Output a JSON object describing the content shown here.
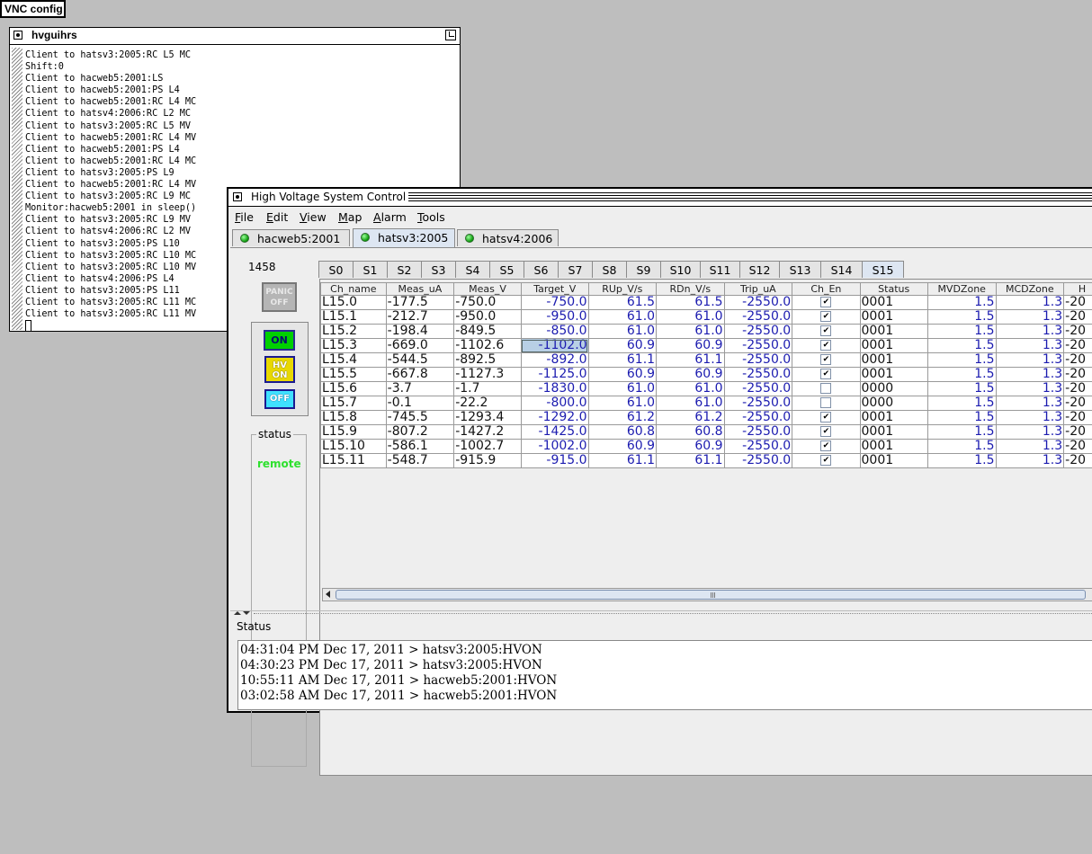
{
  "vnc_label": "VNC config",
  "terminal": {
    "title": "hvguihrs",
    "lines": [
      "Client to hatsv3:2005:RC L5 MC",
      "Shift:0",
      "Client to hacweb5:2001:LS",
      "Client to hacweb5:2001:PS L4",
      "Client to hacweb5:2001:RC L4 MC",
      "Client to hatsv4:2006:RC L2 MC",
      "Client to hatsv3:2005:RC L5 MV",
      "Client to hacweb5:2001:RC L4 MV",
      "Client to hacweb5:2001:PS L4",
      "Client to hacweb5:2001:RC L4 MC",
      "Client to hatsv3:2005:PS L9",
      "Client to hacweb5:2001:RC L4 MV",
      "Client to hatsv3:2005:RC L9 MC",
      "Monitor:hacweb5:2001 in sleep()",
      "Client to hatsv3:2005:RC L9 MV",
      "Client to hatsv4:2006:RC L2 MV",
      "Client to hatsv3:2005:PS L10",
      "Client to hatsv3:2005:RC L10 MC",
      "Client to hatsv3:2005:RC L10 MV",
      "Client to hatsv4:2006:PS L4",
      "Client to hatsv3:2005:PS L11",
      "Client to hatsv3:2005:RC L11 MC",
      "Client to hatsv3:2005:RC L11 MV"
    ]
  },
  "window": {
    "title": "High Voltage System Control"
  },
  "menu": [
    {
      "key": "F",
      "rest": "ile"
    },
    {
      "key": "E",
      "rest": "dit"
    },
    {
      "key": "V",
      "rest": "iew"
    },
    {
      "key": "M",
      "rest": "ap"
    },
    {
      "key": "A",
      "rest": "larm"
    },
    {
      "key": "T",
      "rest": "ools"
    }
  ],
  "servers": [
    "hacweb5:2001",
    "hatsv3:2005",
    "hatsv4:2006"
  ],
  "selected_server": 1,
  "left_panel": {
    "number": "1458",
    "panic_line1": "PANIC",
    "panic_line2": "OFF",
    "on_label": "ON",
    "hv_line1": "HV",
    "hv_line2": "ON",
    "off_label": "OFF",
    "status_label": "status",
    "status_value": "remote",
    "status_color": "#2fe02f"
  },
  "sectors": [
    "S0",
    "S1",
    "S2",
    "S3",
    "S4",
    "S5",
    "S6",
    "S7",
    "S8",
    "S9",
    "S10",
    "S11",
    "S12",
    "S13",
    "S14",
    "S15"
  ],
  "selected_sector": 15,
  "table": {
    "columns": [
      "Ch_name",
      "Meas_uA",
      "Meas_V",
      "Target_V",
      "RUp_V/s",
      "RDn_V/s",
      "Trip_uA",
      "Ch_En",
      "Status",
      "MVDZone",
      "MCDZone",
      "H"
    ],
    "rows": [
      [
        "L15.0",
        "-177.5",
        "-750.0",
        "-750.0",
        "61.5",
        "61.5",
        "-2550.0",
        true,
        "0001",
        "1.5",
        "1.3",
        "-20"
      ],
      [
        "L15.1",
        "-212.7",
        "-950.0",
        "-950.0",
        "61.0",
        "61.0",
        "-2550.0",
        true,
        "0001",
        "1.5",
        "1.3",
        "-20"
      ],
      [
        "L15.2",
        "-198.4",
        "-849.5",
        "-850.0",
        "61.0",
        "61.0",
        "-2550.0",
        true,
        "0001",
        "1.5",
        "1.3",
        "-20"
      ],
      [
        "L15.3",
        "-669.0",
        "-1102.6",
        "-1102.0",
        "60.9",
        "60.9",
        "-2550.0",
        true,
        "0001",
        "1.5",
        "1.3",
        "-20"
      ],
      [
        "L15.4",
        "-544.5",
        "-892.5",
        "-892.0",
        "61.1",
        "61.1",
        "-2550.0",
        true,
        "0001",
        "1.5",
        "1.3",
        "-20"
      ],
      [
        "L15.5",
        "-667.8",
        "-1127.3",
        "-1125.0",
        "60.9",
        "60.9",
        "-2550.0",
        true,
        "0001",
        "1.5",
        "1.3",
        "-20"
      ],
      [
        "L15.6",
        "-3.7",
        "-1.7",
        "-1830.0",
        "61.0",
        "61.0",
        "-2550.0",
        false,
        "0000",
        "1.5",
        "1.3",
        "-20"
      ],
      [
        "L15.7",
        "-0.1",
        "-22.2",
        "-800.0",
        "61.0",
        "61.0",
        "-2550.0",
        false,
        "0000",
        "1.5",
        "1.3",
        "-20"
      ],
      [
        "L15.8",
        "-745.5",
        "-1293.4",
        "-1292.0",
        "61.2",
        "61.2",
        "-2550.0",
        true,
        "0001",
        "1.5",
        "1.3",
        "-20"
      ],
      [
        "L15.9",
        "-807.2",
        "-1427.2",
        "-1425.0",
        "60.8",
        "60.8",
        "-2550.0",
        true,
        "0001",
        "1.5",
        "1.3",
        "-20"
      ],
      [
        "L15.10",
        "-586.1",
        "-1002.7",
        "-1002.0",
        "60.9",
        "60.9",
        "-2550.0",
        true,
        "0001",
        "1.5",
        "1.3",
        "-20"
      ],
      [
        "L15.11",
        "-548.7",
        "-915.9",
        "-915.0",
        "61.1",
        "61.1",
        "-2550.0",
        true,
        "0001",
        "1.5",
        "1.3",
        "-20"
      ]
    ],
    "selected_cell": {
      "row": 3,
      "col": 3
    }
  },
  "status_panel": {
    "label": "Status",
    "entries": [
      "04:31:04 PM Dec 17, 2011 > hatsv3:2005:HVON",
      "04:30:23 PM Dec 17, 2011 > hatsv3:2005:HVON",
      "10:55:11 AM Dec 17, 2011 > hacweb5:2001:HVON",
      "03:02:58 AM Dec 17, 2011 > hacweb5:2001:HVON"
    ]
  }
}
